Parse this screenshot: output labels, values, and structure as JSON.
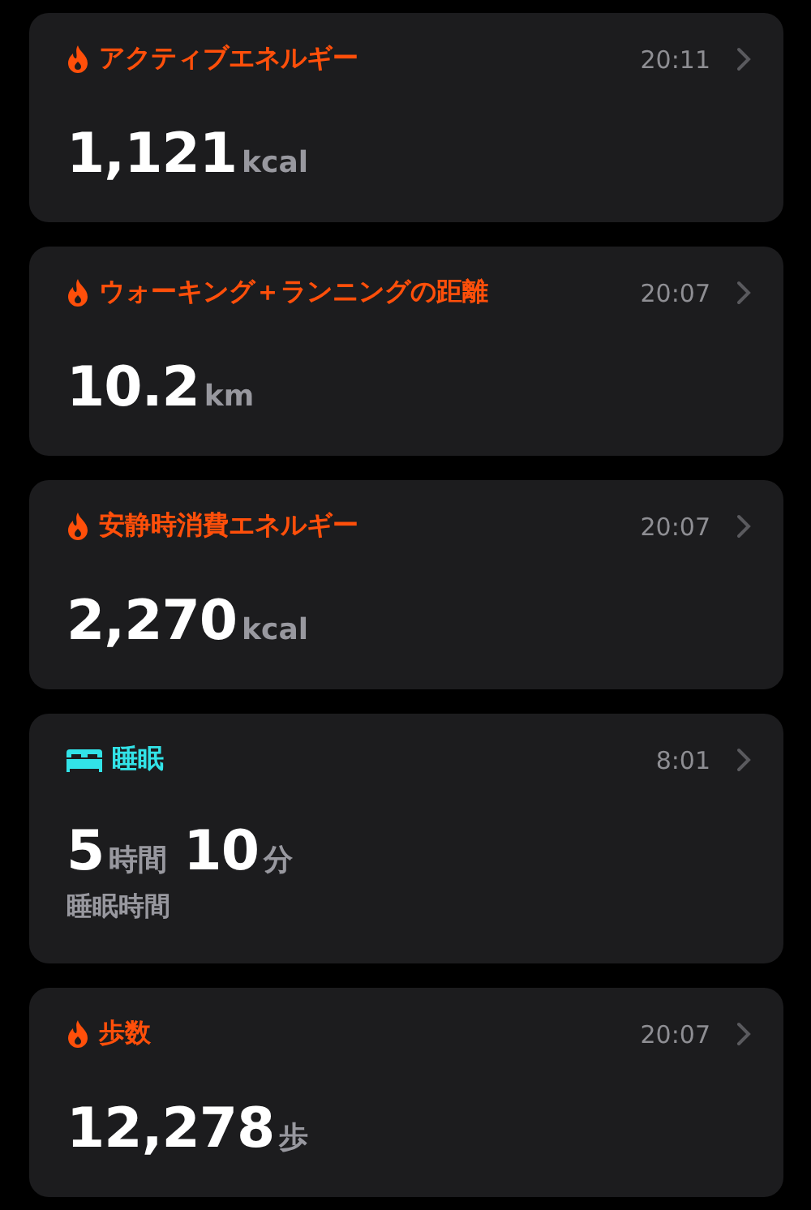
{
  "cards": [
    {
      "kind": "flame",
      "color": "#ff4f0a",
      "title": "アクティブエネルギー",
      "time": "20:11",
      "value": [
        {
          "number": "1,121",
          "unit": "kcal"
        }
      ]
    },
    {
      "kind": "flame",
      "color": "#ff4f0a",
      "title": "ウォーキング＋ランニングの距離",
      "time": "20:07",
      "value": [
        {
          "number": "10.2",
          "unit": "km"
        }
      ]
    },
    {
      "kind": "flame",
      "color": "#ff4f0a",
      "title": "安静時消費エネルギー",
      "time": "20:07",
      "value": [
        {
          "number": "2,270",
          "unit": "kcal"
        }
      ]
    },
    {
      "kind": "bed",
      "color": "#32e3e8",
      "title": "睡眠",
      "time": "8:01",
      "value": [
        {
          "number": "5",
          "unit": "時間"
        },
        {
          "number": "10",
          "unit": "分"
        }
      ],
      "caption": "睡眠時間"
    },
    {
      "kind": "flame",
      "color": "#ff4f0a",
      "title": "歩数",
      "time": "20:07",
      "value": [
        {
          "number": "12,278",
          "unit": "歩"
        }
      ]
    }
  ]
}
